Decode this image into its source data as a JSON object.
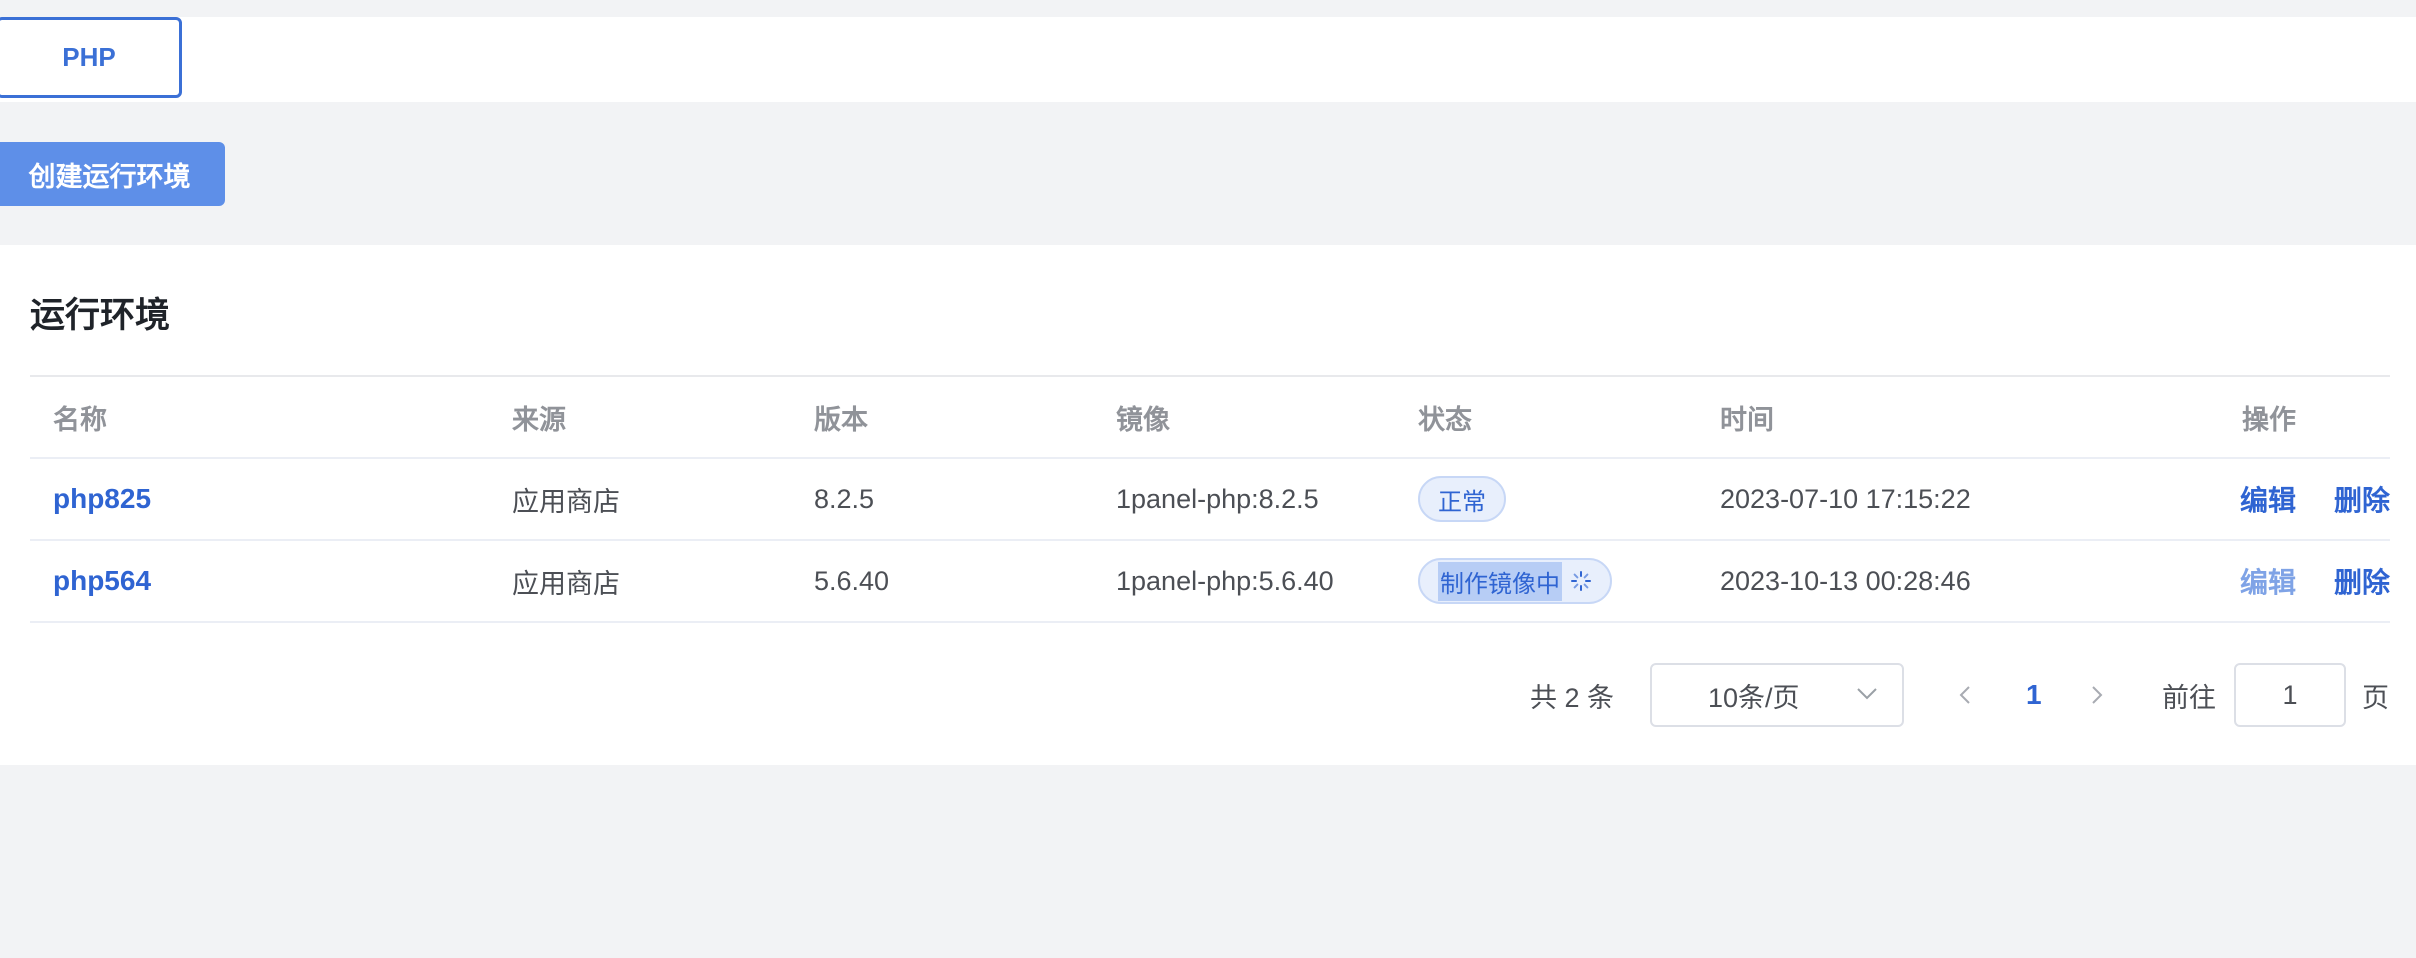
{
  "tabs": {
    "active_label": "PHP"
  },
  "toolbar": {
    "create_label": "创建运行环境"
  },
  "card": {
    "title": "运行环境"
  },
  "table": {
    "headers": {
      "name": "名称",
      "source": "来源",
      "version": "版本",
      "image": "镜像",
      "status": "状态",
      "time": "时间",
      "ops": "操作"
    },
    "rows": [
      {
        "name": "php825",
        "source": "应用商店",
        "version": "8.2.5",
        "image": "1panel-php:8.2.5",
        "status": "正常",
        "time": "2023-07-10 17:15:22",
        "edit": "编辑",
        "delete": "删除"
      },
      {
        "name": "php564",
        "source": "应用商店",
        "version": "5.6.40",
        "image": "1panel-php:5.6.40",
        "status": "制作镜像中",
        "time": "2023-10-13 00:28:46",
        "edit": "编辑",
        "delete": "删除"
      }
    ]
  },
  "pagination": {
    "total": "共 2 条",
    "page_size": "10条/页",
    "current_page": "1",
    "goto_label": "前往",
    "goto_value": "1",
    "page_suffix": "页"
  },
  "colors": {
    "accent": "#2f64d2",
    "button": "#5e8fe8",
    "background": "#f2f3f5"
  }
}
